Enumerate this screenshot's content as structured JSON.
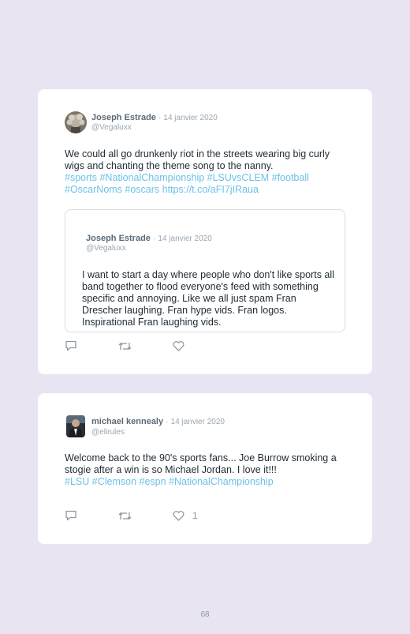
{
  "tweets": [
    {
      "author": "Joseph Estrade",
      "separator": "·",
      "date": "14 janvier 2020",
      "handle": "@Vegaluxx",
      "text_plain": "We could all go drunkenly riot in the streets wearing big curly wigs and chanting the theme song to the nanny.",
      "tags_line1": "#sports #NationalChampionship #LSUvsCLEM #football",
      "tags_line2": "#OscarNoms #oscars https://t.co/aFI7jIRaua",
      "quoted": {
        "author": "Joseph Estrade",
        "separator": "·",
        "date": "14 janvier 2020",
        "handle": "@Vegaluxx",
        "text": "I want to start a day where people who don't like sports all band together to flood everyone's feed with something specific and annoying. Like we all just spam Fran Drescher laughing. Fran hype vids. Fran logos. Inspirational Fran laughing vids."
      },
      "icons": [
        "reply-icon",
        "retweet-icon",
        "like-icon"
      ]
    },
    {
      "author": "michael kennealy",
      "separator": "·",
      "date": "14 janvier 2020",
      "handle": "@elirules",
      "text_plain": "Welcome back to the 90's sports fans... Joe Burrow smoking a stogie after a win is so Michael Jordan. I love it!!!",
      "tags_line1": "#LSU #Clemson #espn #NationalChampionship",
      "like_count": "1",
      "icons": [
        "reply-icon",
        "retweet-icon",
        "like-icon"
      ]
    }
  ],
  "page_number": "68",
  "colors": {
    "background": "#e8e4f2",
    "card": "#ffffff",
    "hashtag": "#6cc1ea",
    "text": "#1e2a33",
    "muted": "#9aa6b0"
  }
}
